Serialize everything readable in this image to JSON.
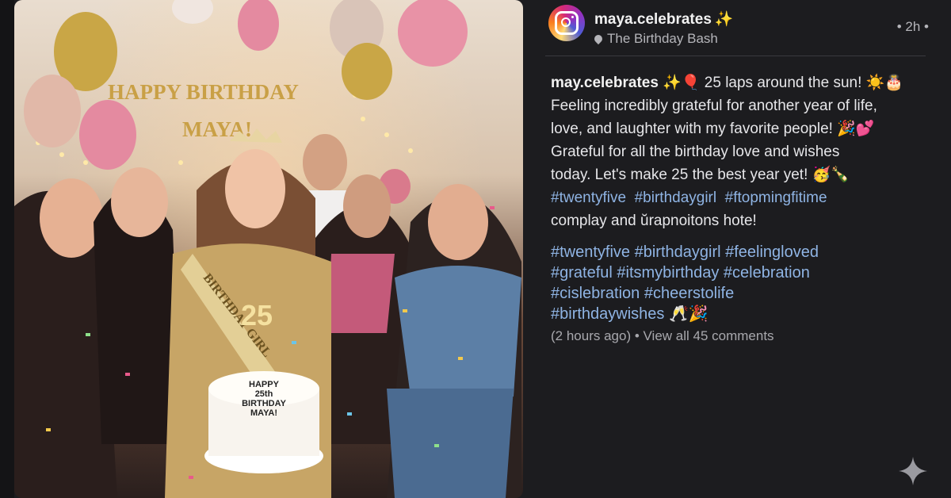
{
  "post": {
    "username": "maya.celebrates",
    "username_emoji": "✨",
    "location": "The Birthday Bash",
    "time": "• 2h •",
    "caption_author": "may.celebrates",
    "caption_line1": " ✨🎈 25 laps around the sun! ☀️🎂",
    "caption_line2": "Feeling incredibly grateful for another year of life,",
    "caption_line3": "love, and  laughter with my favorite people! 🎉💕",
    "caption_line4": "Grateful for all the birthday love and wishes",
    "caption_line5": "today. Let's make 25 the best year yet! 🥳🍾",
    "inline_tags": [
      "#twentyfive",
      "#birthdaygirl",
      "#ftopmingfitime"
    ],
    "caption_line7": "complay and  ŭrapnoitons hote!",
    "hashtags_line1": "#twentyfive #birthdaygirl #feelingloved",
    "hashtags_line2": "#grateful #itsmybirthday #celebration",
    "hashtags_line3": "#cislebration #cheerstolife",
    "hashtags_line4": "#birthdaywishes",
    "hashtags_emoji": "🥂🎉",
    "meta": "(2 hours ago) • View all 45 comments"
  },
  "photo": {
    "banner_line1": "HAPPY BIRTHDAY",
    "banner_line2": "MAYA!",
    "sash_text": "BIRTHDAY GIRL",
    "candle_number": "25",
    "cake_line1": "HAPPY",
    "cake_line2": "25th",
    "cake_line3": "BIRTHDAY",
    "cake_line4": "MAYA!"
  },
  "icons": {
    "avatar": "instagram-logo-icon",
    "location": "map-pin-icon",
    "sparkle": "sparkle-icon"
  },
  "colors": {
    "background": "#1c1c1f",
    "hashtag": "#8fb4e4",
    "muted": "#b5b5ba"
  }
}
